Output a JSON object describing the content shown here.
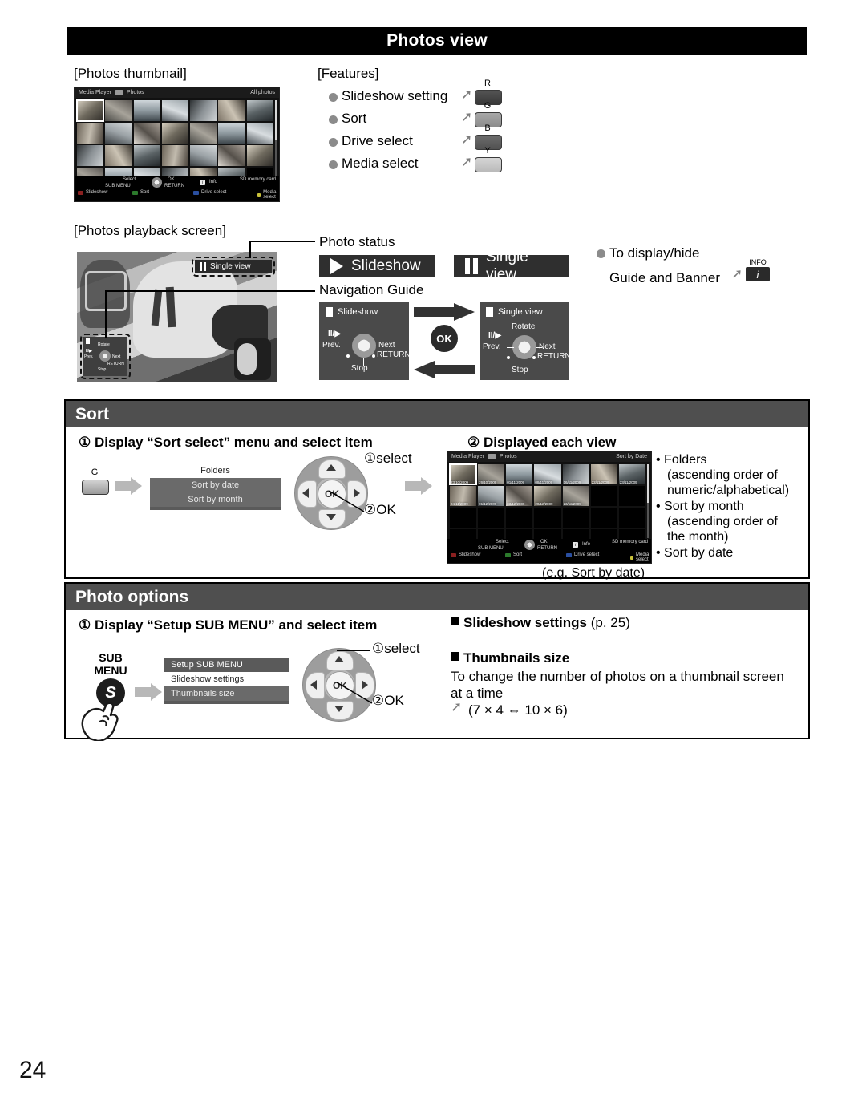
{
  "page": {
    "number": "24",
    "title": "Photos view"
  },
  "photos_view": {
    "thumbnail_caption": "[Photos thumbnail]",
    "features_caption": "[Features]",
    "playback_caption": "[Photos playback screen]",
    "features": [
      {
        "label": "Slideshow setting",
        "key": "R",
        "key_color": "#545454"
      },
      {
        "label": "Sort",
        "key": "G",
        "key_color": "#a8a8a8"
      },
      {
        "label": "Drive select",
        "key": "B",
        "key_color": "#6d6d6d"
      },
      {
        "label": "Media select",
        "key": "Y",
        "key_color": "#d6d6d6"
      }
    ],
    "photo_status_label": "Photo status",
    "navigation_guide_label": "Navigation Guide",
    "status_pills": [
      {
        "icon": "play-icon",
        "label": "Slideshow"
      },
      {
        "icon": "pause-icon",
        "label": "Single view"
      }
    ],
    "overlay_badge": {
      "icon": "pause-icon",
      "label": "Single view"
    },
    "display_hide": {
      "line1": "To display/hide",
      "line2": "Guide and Banner",
      "key": "INFO",
      "key_glyph": "i"
    },
    "nav_cards": [
      {
        "title": "Slideshow",
        "up": "",
        "left": "Prev.",
        "left_top": "II/▶",
        "right": "Next",
        "down": "Stop",
        "return": "RETURN"
      },
      {
        "title": "Single view",
        "up": "Rotate",
        "left": "Prev.",
        "left_top": "II/▶",
        "right": "Next",
        "down": "Stop",
        "return": "RETURN"
      }
    ],
    "ok_badge": "OK"
  },
  "tv_thumbnail": {
    "breadcrumb_left": "Media Player",
    "breadcrumb_right": "Photos",
    "mode_label": "All photos",
    "footer": {
      "select": "Select",
      "ok": "OK",
      "sub_menu": "SUB MENU",
      "return": "RETURN",
      "info": "Info",
      "media": "SD memory card",
      "keys": [
        {
          "label": "Slideshow",
          "color": "#8a2020"
        },
        {
          "label": "Sort",
          "color": "#2c7a2c"
        },
        {
          "label": "Drive select",
          "color": "#2a4fa0"
        },
        {
          "label": "Media select",
          "color": "#c9c13a"
        }
      ]
    }
  },
  "tv_sorted": {
    "breadcrumb_left": "Media Player",
    "breadcrumb_right": "Photos",
    "mode_label": "Sort by Date",
    "dates_row1": [
      "23/10/2009",
      "26/10/2009",
      "01/11/2009",
      "08/11/2009",
      "16/11/2009",
      "22/11/2009",
      "23/11/2009"
    ],
    "dates_row2": [
      "24/11/2009",
      "01/12/2009",
      "03/12/2009",
      "20/12/2009",
      "23/12/2009"
    ],
    "caption": "(e.g. Sort by date)"
  },
  "sort_section": {
    "heading": "Sort",
    "step1": "① Display “Sort select” menu and select item",
    "step2": "② Displayed each view",
    "trigger_key": "G",
    "menu": {
      "title": "Folders",
      "items": [
        "Sort by date",
        "Sort by month"
      ]
    },
    "dpad": {
      "select_note": "①select",
      "ok_note": "②OK",
      "ok_label": "OK"
    },
    "notes": [
      "Folders",
      "(ascending order of",
      "numeric/alphabetical)",
      " Sort by month",
      "(ascending order of",
      "the month)",
      "Sort by date"
    ]
  },
  "photo_options": {
    "heading": "Photo options",
    "step1": "① Display “Setup SUB MENU” and select item",
    "sub_menu_button": {
      "line1": "SUB",
      "line2": "MENU",
      "glyph": "S"
    },
    "menu": {
      "title": "Setup SUB MENU",
      "items": [
        "Slideshow settings",
        "Thumbnails size"
      ]
    },
    "dpad": {
      "select_note": "①select",
      "ok_note": "②OK",
      "ok_label": "OK"
    },
    "right": {
      "slideshow_settings": "Slideshow settings",
      "slideshow_settings_page": "(p. 25)",
      "thumbnails_size": "Thumbnails size",
      "desc_line1": "To change the number of photos on a thumbnail screen",
      "desc_line2": "at a time",
      "desc_line3": "(7 × 4 ⇔ 10 × 6)"
    }
  }
}
